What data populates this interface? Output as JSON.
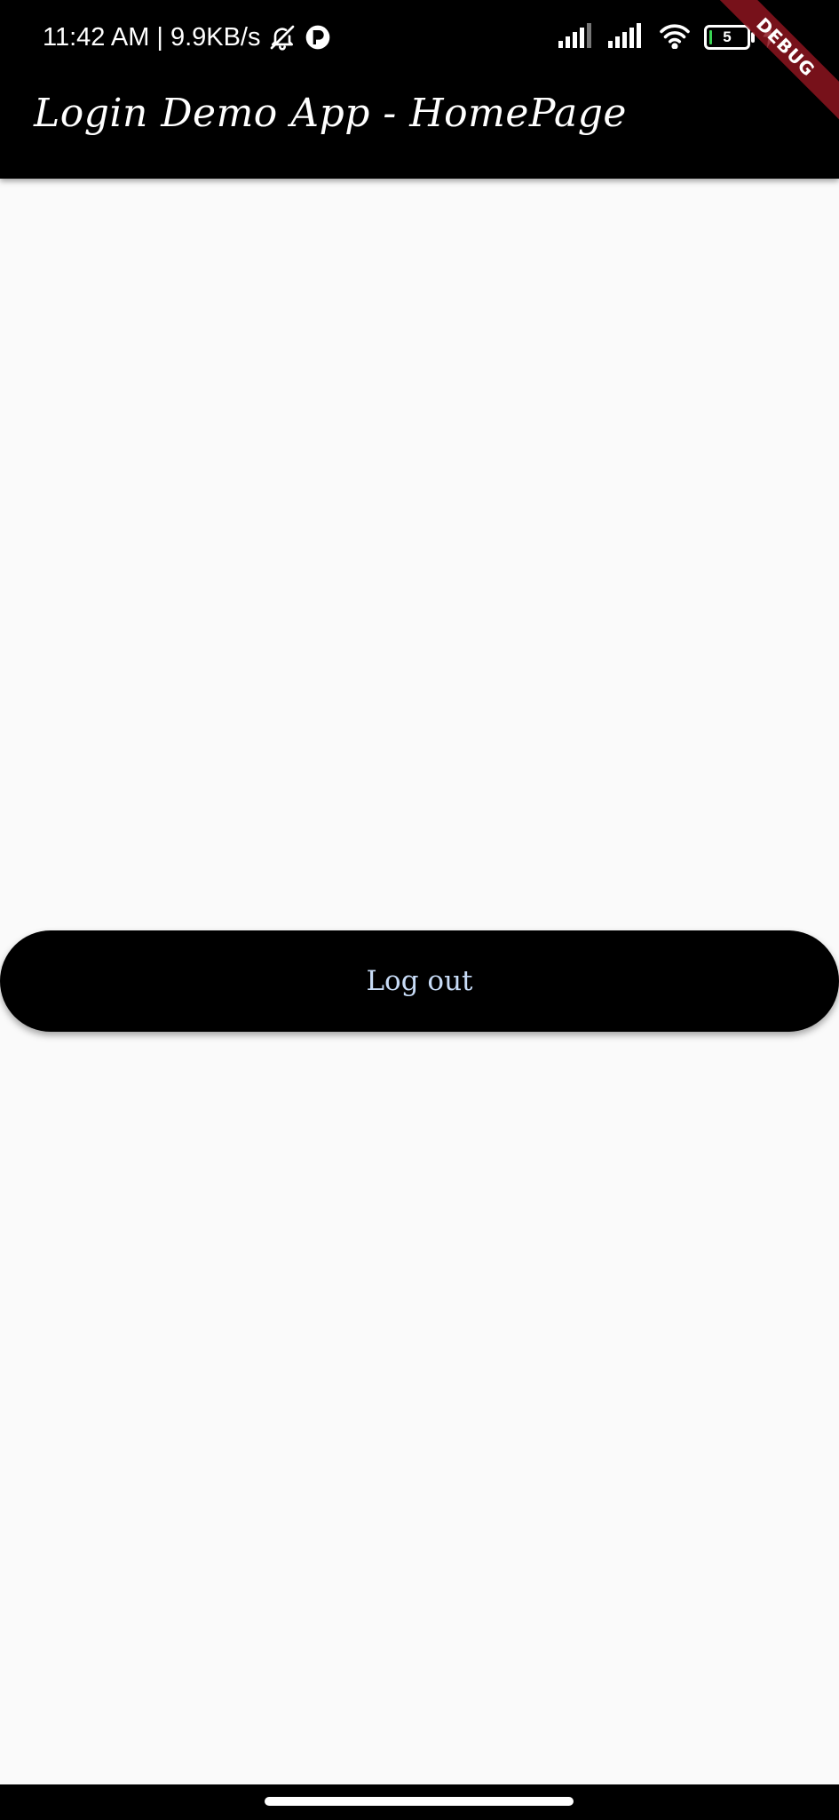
{
  "status_bar": {
    "time": "11:42 AM",
    "separator": "|",
    "network_speed": "9.9KB/s",
    "battery_level": "5",
    "icons": [
      "bell-off-icon",
      "app-notification-icon",
      "signal-icon",
      "signal-icon",
      "wifi-icon",
      "battery-icon",
      "charging-icon"
    ]
  },
  "debug_banner": {
    "label": "DEBUG"
  },
  "app_bar": {
    "title": "Login Demo App - HomePage"
  },
  "main": {
    "logout_label": "Log out"
  },
  "colors": {
    "app_bar_background": "#000000",
    "page_background": "#fafafa",
    "button_background": "#000000",
    "button_text": "#c8dcf7",
    "debug_ribbon": "#8c141e"
  }
}
